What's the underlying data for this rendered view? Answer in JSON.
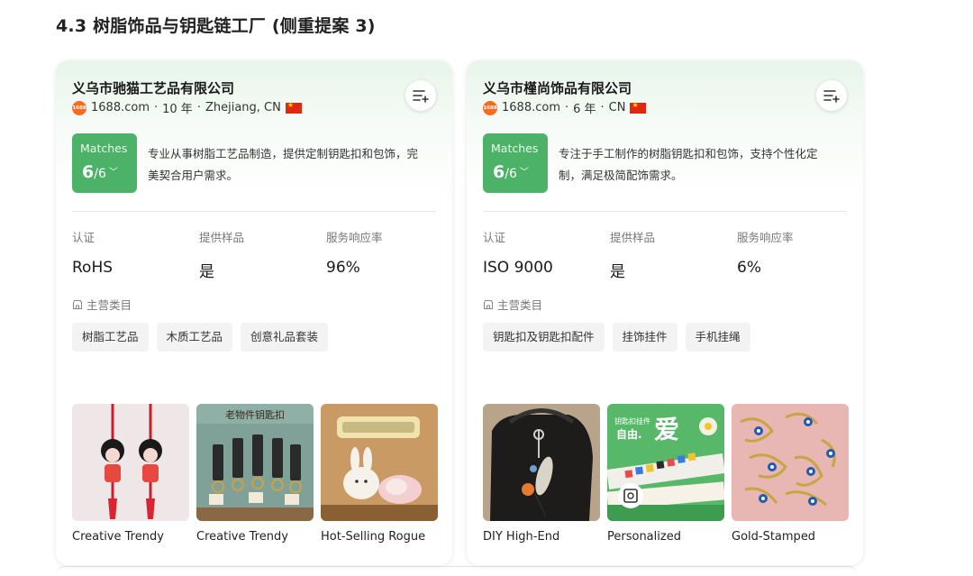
{
  "section_title": "4.3 树脂饰品与钥匙链工厂 (侧重提案 3)",
  "cards": [
    {
      "company": "义乌市驰猫工艺品有限公司",
      "logo_text": "1688",
      "platform": "1688.com",
      "years": "10 年",
      "location": "Zhejiang, CN",
      "matches_label": "Matches",
      "matches_num": "6",
      "matches_den": "/6",
      "description": "专业从事树脂工艺品制造，提供定制钥匙扣和包饰，完美契合用户需求。",
      "stats": [
        {
          "label": "认证",
          "value": "RoHS"
        },
        {
          "label": "提供样品",
          "value": "是"
        },
        {
          "label": "服务响应率",
          "value": "96%"
        }
      ],
      "category_head": "主营类目",
      "tags": [
        "树脂工艺品",
        "木质工艺品",
        "创意礼品套装"
      ],
      "products": [
        {
          "name": "Creative Trendy",
          "image": "red-tassel-keychains"
        },
        {
          "name": "Creative Trendy",
          "image": "wooden-tag-keychains"
        },
        {
          "name": "Hot-Selling Rogue",
          "image": "resin-bunny-figurines"
        }
      ]
    },
    {
      "company": "义乌市槿尚饰品有限公司",
      "logo_text": "1688",
      "platform": "1688.com",
      "years": "6 年",
      "location": "CN",
      "matches_label": "Matches",
      "matches_num": "6",
      "matches_den": "/6",
      "description": "专注于手工制作的树脂钥匙扣和包饰，支持个性化定制，满足极简配饰需求。",
      "stats": [
        {
          "label": "认证",
          "value": "ISO 9000"
        },
        {
          "label": "提供样品",
          "value": "是"
        },
        {
          "label": "服务响应率",
          "value": "6%"
        }
      ],
      "category_head": "主营类目",
      "tags": [
        "钥匙扣及钥匙扣配件",
        "挂饰挂件",
        "手机挂绳"
      ],
      "products": [
        {
          "name": "DIY High-End",
          "image": "bag-charm-on-black-bag"
        },
        {
          "name": "Personalized",
          "image": "letter-bead-keychains",
          "overlay_text": "钥匙扣挂件 自由 爱"
        },
        {
          "name": "Gold-Stamped",
          "image": "gold-evil-eye-keychains"
        }
      ]
    }
  ],
  "colors": {
    "accent_green": "#4bb267",
    "card_gradient_top": "#e7f5ea",
    "logo_orange": "#ff6a1f"
  },
  "icons": [
    "add-to-list-icon",
    "store-icon",
    "chevron-down-icon",
    "image-search-icon",
    "cn-flag-icon"
  ]
}
